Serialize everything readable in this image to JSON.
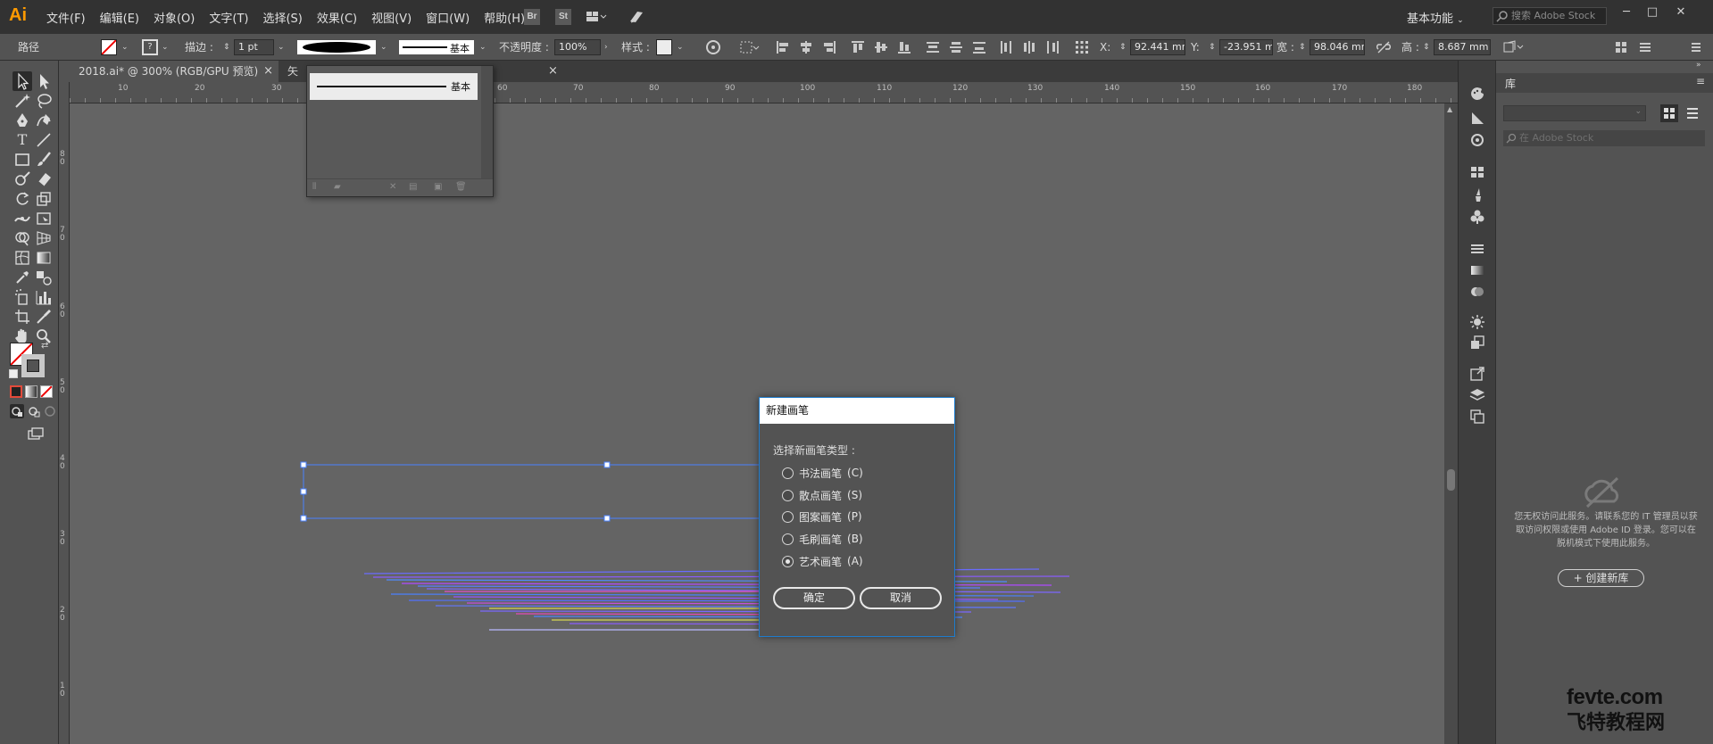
{
  "app": {
    "logo": "Ai",
    "menu": [
      "文件(F)",
      "编辑(E)",
      "对象(O)",
      "文字(T)",
      "选择(S)",
      "效果(C)",
      "视图(V)",
      "窗口(W)",
      "帮助(H)"
    ],
    "bridge": "Br",
    "stock": "St",
    "workspace": "基本功能",
    "search_placeholder": "搜索 Adobe Stock",
    "accent_color": "#ff9a00"
  },
  "control": {
    "selection_label": "路径",
    "stroke_label": "描边 :",
    "stroke_weight": "1 pt",
    "brush_name": "基本",
    "opacity_label": "不透明度 :",
    "opacity_value": "100%",
    "style_label": "样式 :",
    "x_label": "X:",
    "x_value": "92.441 mm",
    "y_label": "Y:",
    "y_value": "-23.951 m",
    "w_label": "宽 :",
    "w_value": "98.046 mm",
    "h_label": "高 :",
    "h_value": "8.687 mm"
  },
  "tabs": [
    {
      "label": "2018.ai* @ 300% (RGB/GPU 预览)",
      "close": "×"
    },
    {
      "label": "矢",
      "close": "×"
    }
  ],
  "ruler": {
    "h_labels": [
      "10",
      "20",
      "30",
      "60",
      "70",
      "80",
      "90",
      "100",
      "110",
      "120",
      "130",
      "140",
      "150",
      "160",
      "170",
      "180"
    ],
    "v_labels": [
      "8 0",
      "7 0",
      "6 0",
      "5 0",
      "4 0",
      "3 0",
      "2 0",
      "1 0"
    ]
  },
  "brush_popover": {
    "item_label": "基本"
  },
  "dialog": {
    "title": "新建画笔",
    "prompt": "选择新画笔类型 :",
    "options": [
      {
        "label": "书法画笔",
        "key": "(C)",
        "selected": false
      },
      {
        "label": "散点画笔",
        "key": "(S)",
        "selected": false
      },
      {
        "label": "图案画笔",
        "key": "(P)",
        "selected": false
      },
      {
        "label": "毛刷画笔",
        "key": "(B)",
        "selected": false
      },
      {
        "label": "艺术画笔",
        "key": "(A)",
        "selected": true
      }
    ],
    "ok": "确定",
    "cancel": "取消",
    "border_color": "#1e7ccd"
  },
  "library": {
    "tab": "库",
    "search_placeholder": "在 Adobe Stock",
    "message": "您无权访问此服务。请联系您的 IT 管理员以获取访问权限或使用 Adobe ID 登录。您可以在脱机模式下使用此服务。",
    "create_button": "+ 创建新库"
  },
  "watermark": {
    "line1": "fevte.com",
    "line2": "飞特教程网"
  }
}
